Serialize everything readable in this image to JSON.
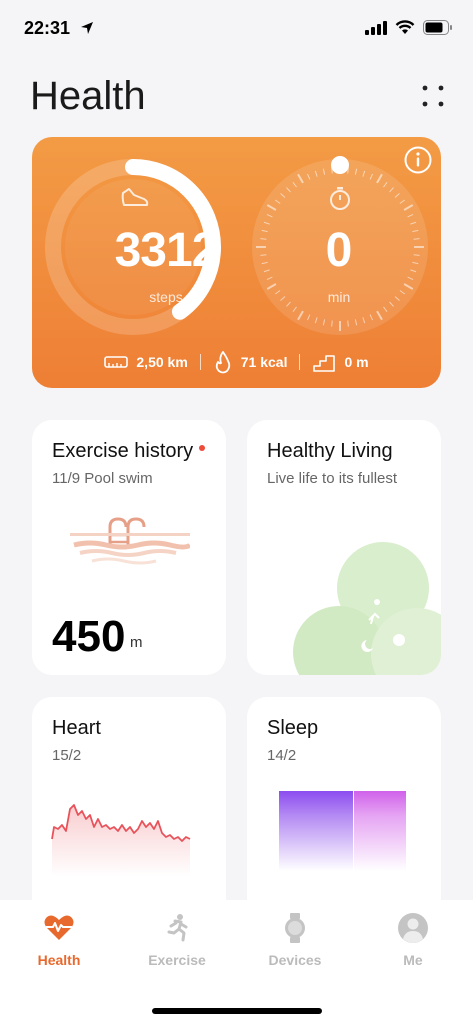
{
  "status_bar": {
    "time": "22:31"
  },
  "header": {
    "title": "Health"
  },
  "summary": {
    "steps_value": "3312",
    "steps_unit": "steps",
    "steps_progress": 0.4,
    "minutes_value": "0",
    "minutes_unit": "min",
    "distance": "2,50 km",
    "calories": "71 kcal",
    "floors": "0 m",
    "accent_color": "#ee7f35"
  },
  "tiles": {
    "exercise": {
      "title": "Exercise history",
      "subtitle": "11/9 Pool swim",
      "value": "450",
      "unit": "m"
    },
    "living": {
      "title": "Healthy Living",
      "subtitle": "Live life to its fullest"
    },
    "heart": {
      "title": "Heart",
      "subtitle": "15/2"
    },
    "sleep": {
      "title": "Sleep",
      "subtitle": "14/2"
    }
  },
  "tab_bar": {
    "tabs": [
      {
        "label": "Health",
        "icon": "heart-pulse-icon",
        "active": true
      },
      {
        "label": "Exercise",
        "icon": "running-icon",
        "active": false
      },
      {
        "label": "Devices",
        "icon": "watch-icon",
        "active": false
      },
      {
        "label": "Me",
        "icon": "avatar-icon",
        "active": false
      }
    ],
    "active_color": "#e8692e"
  }
}
